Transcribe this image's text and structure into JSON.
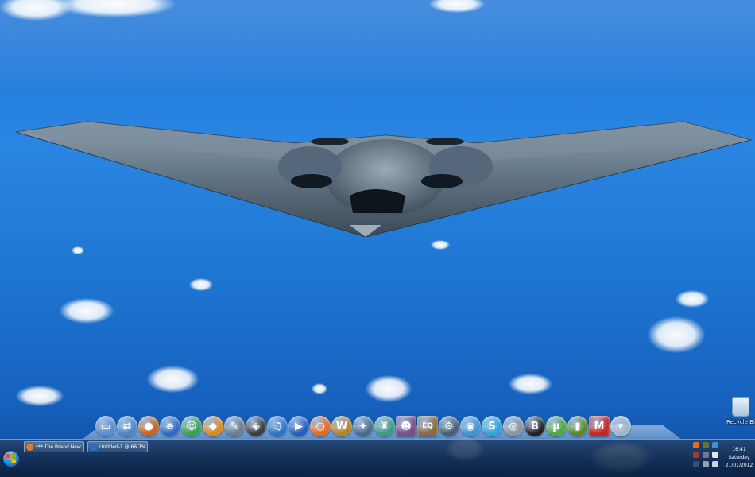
{
  "desktop": {
    "recycle_bin_label": "Recycle Bin"
  },
  "dock": {
    "icons": [
      {
        "name": "my-computer-icon",
        "glyph": "▭",
        "color": "#5b8ccc"
      },
      {
        "name": "network-icon",
        "glyph": "⇄",
        "color": "#4f86c6"
      },
      {
        "name": "firefox-icon",
        "glyph": "●",
        "color": "#c8631d"
      },
      {
        "name": "internet-explorer-icon",
        "glyph": "e",
        "color": "#2b6bc4"
      },
      {
        "name": "messenger-icon",
        "glyph": "☺",
        "color": "#3aa14a"
      },
      {
        "name": "shield-icon",
        "glyph": "◆",
        "color": "#d88a1c"
      },
      {
        "name": "tools-icon",
        "glyph": "✎",
        "color": "#6f7d8c"
      },
      {
        "name": "alien-icon",
        "glyph": "◈",
        "color": "#3c3c3c"
      },
      {
        "name": "itunes-icon",
        "glyph": "♫",
        "color": "#2a73c9"
      },
      {
        "name": "media-player-icon",
        "glyph": "▶",
        "color": "#1f5fbf"
      },
      {
        "name": "origin-icon",
        "glyph": "○",
        "color": "#e36a1f"
      },
      {
        "name": "warcraft-icon",
        "glyph": "W",
        "color": "#b48326"
      },
      {
        "name": "starcraft-icon",
        "glyph": "✦",
        "color": "#4b6a8a"
      },
      {
        "name": "game-figure-icon",
        "glyph": "♜",
        "color": "#3b9b7f"
      },
      {
        "name": "game-portrait-icon",
        "glyph": "☻",
        "color": "#7a4f8a"
      },
      {
        "name": "everquest-icon",
        "glyph": "EQ",
        "color": "#8a6b3e"
      },
      {
        "name": "steam-icon",
        "glyph": "⚙",
        "color": "#4a5d72"
      },
      {
        "name": "chat-bubble-icon",
        "glyph": "◉",
        "color": "#3f95d1"
      },
      {
        "name": "skype-icon",
        "glyph": "S",
        "color": "#2aa6df"
      },
      {
        "name": "alarm-icon",
        "glyph": "◎",
        "color": "#8a949e"
      },
      {
        "name": "hl-icon",
        "glyph": "B",
        "color": "#222222"
      },
      {
        "name": "utorrent-icon",
        "glyph": "μ",
        "color": "#4ea83c"
      },
      {
        "name": "bars-icon",
        "glyph": "▮",
        "color": "#5a8a2a"
      },
      {
        "name": "malwarebytes-icon",
        "glyph": "M",
        "color": "#c8261f"
      },
      {
        "name": "trash-icon",
        "glyph": "▾",
        "color": "#9fb6cc"
      }
    ]
  },
  "taskbar": {
    "buttons": [
      {
        "label": "*** The Brand New P...",
        "color": "#e37a24"
      },
      {
        "label": "Untitled-1 @ 66.7% (...",
        "color": "#2c6fb8"
      }
    ],
    "tray_colors": [
      "#e36a1f",
      "#5d7a2e",
      "#3a8fd6",
      "#9e3b2d",
      "#6b7b8c",
      "#e0e6ec",
      "#3c4f66",
      "#8ea2b8",
      "#c7d4e0"
    ],
    "clock": {
      "time": "16:41",
      "day": "Saturday",
      "date": "21/01/2012"
    }
  }
}
